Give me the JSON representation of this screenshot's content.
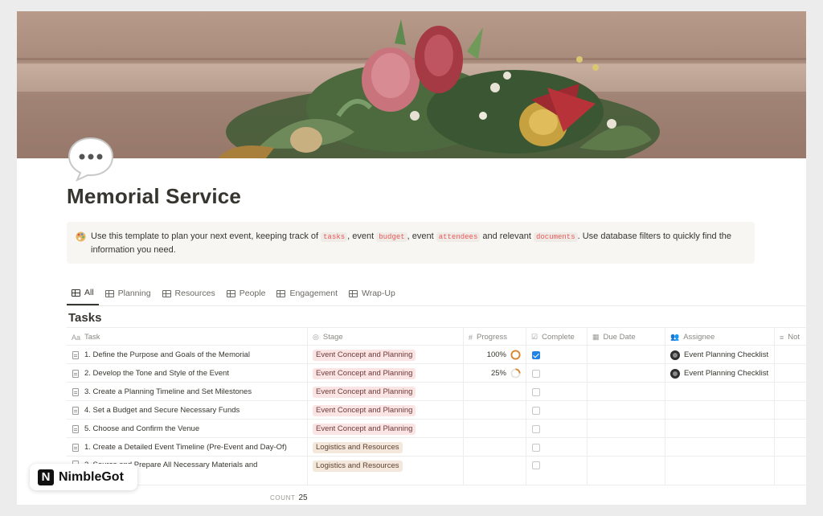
{
  "page": {
    "title": "Memorial Service",
    "callout": {
      "t1": "Use this template to plan your next event, keeping track of ",
      "tag1": "tasks",
      "t2": ", event ",
      "tag2": "budget",
      "t3": ", event ",
      "tag3": "attendees",
      "t4": " and relevant ",
      "tag4": "documents",
      "t5": ". Use database filters to quickly find the information you need."
    }
  },
  "tabs": [
    {
      "label": "All",
      "active": true
    },
    {
      "label": "Planning"
    },
    {
      "label": "Resources"
    },
    {
      "label": "People"
    },
    {
      "label": "Engagement"
    },
    {
      "label": "Wrap-Up"
    }
  ],
  "database": {
    "title": "Tasks",
    "columns": {
      "task": "Task",
      "stage": "Stage",
      "progress": "Progress",
      "complete": "Complete",
      "due": "Due Date",
      "assignee": "Assignee",
      "notes": "Not"
    },
    "rows": [
      {
        "task": "1. Define the Purpose and Goals of the Memorial",
        "stage": "Event Concept and Planning",
        "progress": "100%",
        "complete": true,
        "assignee": "Event Planning Checklist"
      },
      {
        "task": "2. Develop the Tone and Style of the Event",
        "stage": "Event Concept and Planning",
        "progress": "25%",
        "complete": false,
        "assignee": "Event Planning Checklist"
      },
      {
        "task": "3. Create a Planning Timeline and Set Milestones",
        "stage": "Event Concept and Planning",
        "complete": false
      },
      {
        "task": "4. Set a Budget and Secure Necessary Funds",
        "stage": "Event Concept and Planning",
        "complete": false
      },
      {
        "task": "5. Choose and Confirm the Venue",
        "stage": "Event Concept and Planning",
        "complete": false
      },
      {
        "task": "1. Create a Detailed Event Timeline (Pre-Event and Day-Of)",
        "stage": "Logistics and Resources",
        "complete": false
      },
      {
        "task": "2. Source and Prepare All Necessary Materials and",
        "stage": "Logistics and Resources",
        "complete": false
      }
    ],
    "count_label": "COUNT",
    "count_value": "25"
  },
  "watermark": {
    "logo_letter": "N",
    "text": "NimbleGot"
  },
  "colors": {
    "accent": "#2383e2",
    "stage_red": "#fbe4e4",
    "stage_brown": "#f4e7dc",
    "progress_ring": "#d9822b"
  }
}
